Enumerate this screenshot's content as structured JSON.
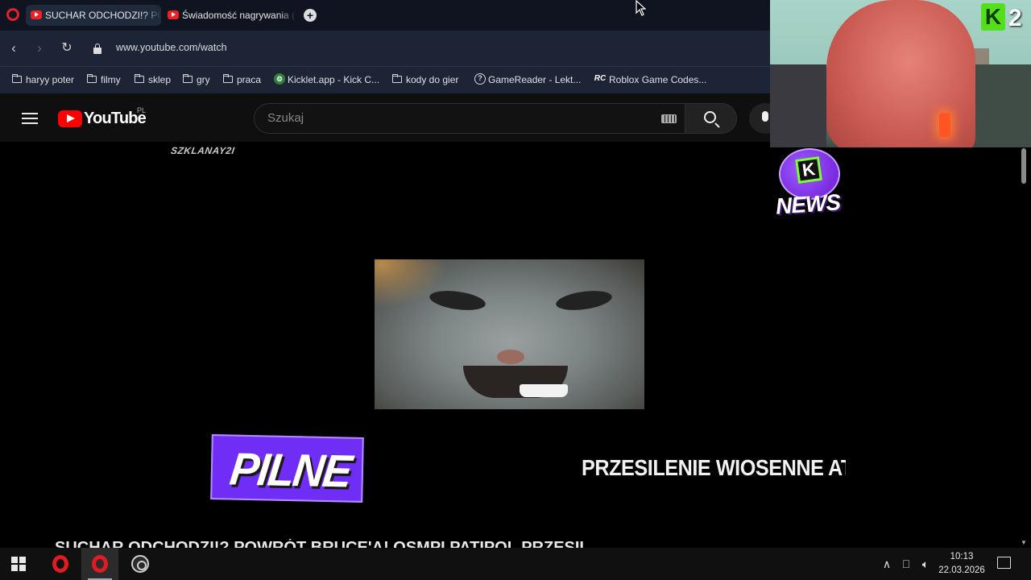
{
  "browser": {
    "tabs": [
      {
        "title": "SUCHAR ODCHODZI!? POWRÓT",
        "active": true
      },
      {
        "title": "Świadomość nagrywania (",
        "active": false
      }
    ],
    "new_tab_label": "+",
    "url": "www.youtube.com/watch",
    "bookmarks": [
      {
        "label": "haryy poter",
        "icon": "folder-icon"
      },
      {
        "label": "filmy",
        "icon": "folder-icon"
      },
      {
        "label": "sklep",
        "icon": "folder-icon"
      },
      {
        "label": "gry",
        "icon": "folder-icon"
      },
      {
        "label": "praca",
        "icon": "folder-icon"
      },
      {
        "label": "Kicklet.app - Kick C...",
        "icon": "kicklet-icon"
      },
      {
        "label": "kody do gier",
        "icon": "folder-icon"
      },
      {
        "label": "GameReader - Lekt...",
        "icon": "gamereader-icon"
      },
      {
        "label": "Roblox Game Codes...",
        "icon": "rc-icon",
        "icon_text": "RC"
      }
    ]
  },
  "youtube": {
    "wordmark": "YouTube",
    "region": "PL",
    "search_placeholder": "Szukaj"
  },
  "video": {
    "watermark": "SZKLANAY2I",
    "channel_logo_letter": "K",
    "channel_logo_text": "NEWS",
    "pilne_label": "PILNE",
    "ticker_text": "PRZESILENIE WIOSENNE ATAKUJE",
    "title_partial": "SUCHAR ODCHODZI!? POWRÓT BRUCE'A! OSMPI PATIPOL PRZESILENIE"
  },
  "webcam": {
    "badge_letter": "K",
    "badge_number": "2"
  },
  "taskbar": {
    "time": "10:13",
    "date": "22.03.2026",
    "tray_icons": [
      "chevron-up-icon",
      "network-icon",
      "volume-icon"
    ]
  },
  "colors": {
    "browser_bg": "#0f1420",
    "youtube_red": "#ff0000",
    "pilne_purple": "#6f2df5",
    "kick_green": "#53e01a"
  }
}
